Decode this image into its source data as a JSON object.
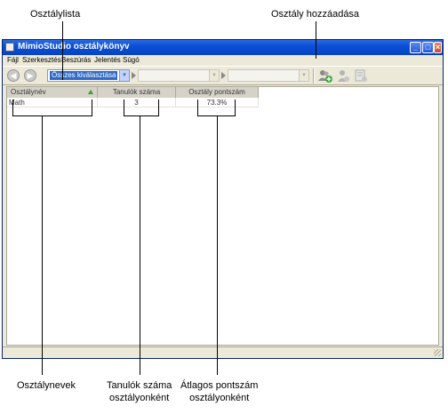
{
  "callouts": {
    "class_list": "Osztálylista",
    "add_class": "Osztály hozzáadása",
    "class_names": "Osztálynevek",
    "students_per_class_1": "Tanulók száma",
    "students_per_class_2": "osztályonként",
    "average_score_1": "Átlagos pontszám",
    "average_score_2": "osztályonként"
  },
  "window": {
    "title": "MimioStudio osztálykönyv"
  },
  "menu": [
    "Fájl",
    "Szerkesztés",
    "Beszúrás",
    "Jelentés",
    "Súgó"
  ],
  "toolbar": {
    "class_select_value": "Összes kiválasztása"
  },
  "grid": {
    "columns": [
      "Osztálynév",
      "Tanulók száma",
      "Osztály pontszám"
    ],
    "rows": [
      {
        "name": "Math",
        "students": "3",
        "score": "73.3%"
      }
    ]
  }
}
